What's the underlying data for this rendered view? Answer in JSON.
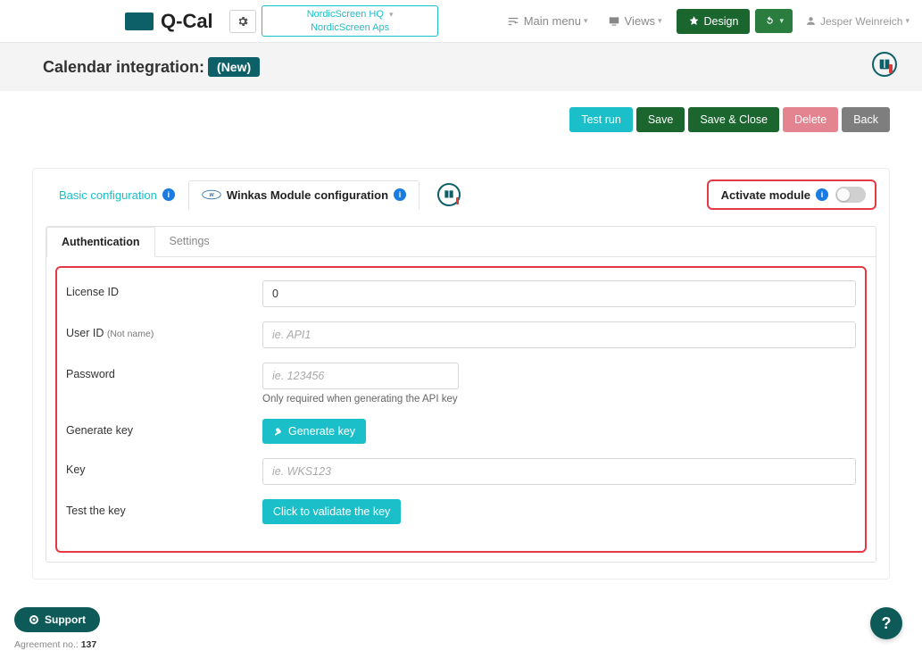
{
  "brand": "Q-Cal",
  "org": {
    "line1": "NordicScreen HQ",
    "line2": "NordicScreen Aps"
  },
  "nav": {
    "main_menu": "Main menu",
    "views": "Views",
    "design": "Design"
  },
  "user": "Jesper Weinreich",
  "page": {
    "title": "Calendar integration:",
    "badge": "(New)"
  },
  "actions": {
    "test_run": "Test run",
    "save": "Save",
    "save_close": "Save & Close",
    "delete": "Delete",
    "back": "Back"
  },
  "top_tabs": {
    "basic": "Basic configuration",
    "winkas": "Winkas Module configuration"
  },
  "activate": {
    "label": "Activate module"
  },
  "panel_tabs": {
    "auth": "Authentication",
    "settings": "Settings"
  },
  "form": {
    "license": {
      "label": "License ID",
      "value": "0"
    },
    "user": {
      "label": "User ID ",
      "sub": "(Not name)",
      "placeholder": "ie. API1"
    },
    "password": {
      "label": "Password",
      "placeholder": "ie. 123456",
      "helper": "Only required when generating the API key"
    },
    "generate": {
      "label": "Generate key",
      "button": "Generate key"
    },
    "key": {
      "label": "Key",
      "placeholder": "ie. WKS123"
    },
    "test": {
      "label": "Test the key",
      "button": "Click to validate the key"
    }
  },
  "support": "Support",
  "agreement": {
    "label": "Agreement no.: ",
    "number": "137"
  }
}
